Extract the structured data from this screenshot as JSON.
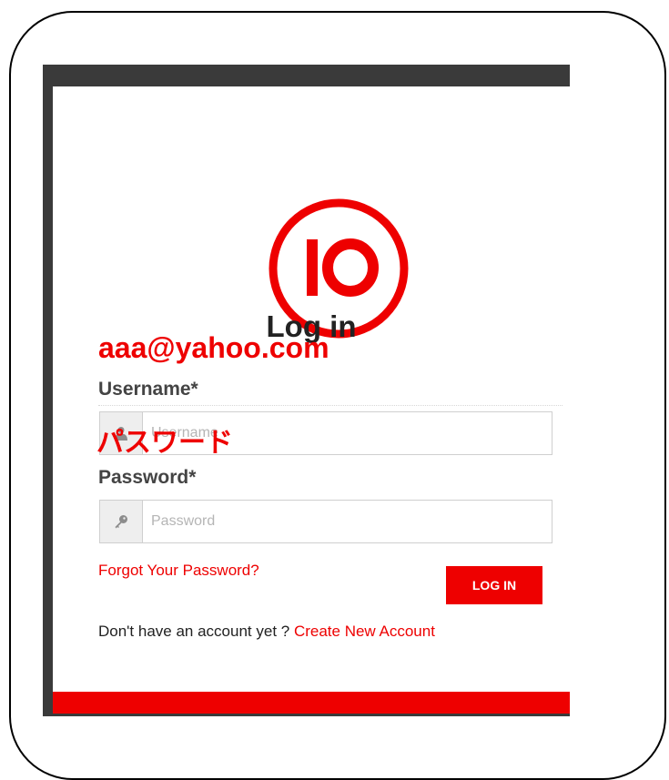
{
  "login": {
    "title": "Log in",
    "username_label": "Username*",
    "username_placeholder": "Username",
    "username_value": "aaa@yahoo.com",
    "password_label": "Password*",
    "password_placeholder": "Password",
    "password_value": "パスワード",
    "forgot_link": "Forgot Your Password?",
    "login_button": "LOG IN",
    "signup_prompt": "Don't have an account yet ? ",
    "signup_link": "Create New Account"
  },
  "logo": {
    "text": "IO"
  },
  "icons": {
    "username": "user-icon",
    "password": "key-icon"
  },
  "colors": {
    "accent": "#ee0000",
    "panel_dark": "#3a3a3a",
    "addon_bg": "#eeeeee"
  }
}
